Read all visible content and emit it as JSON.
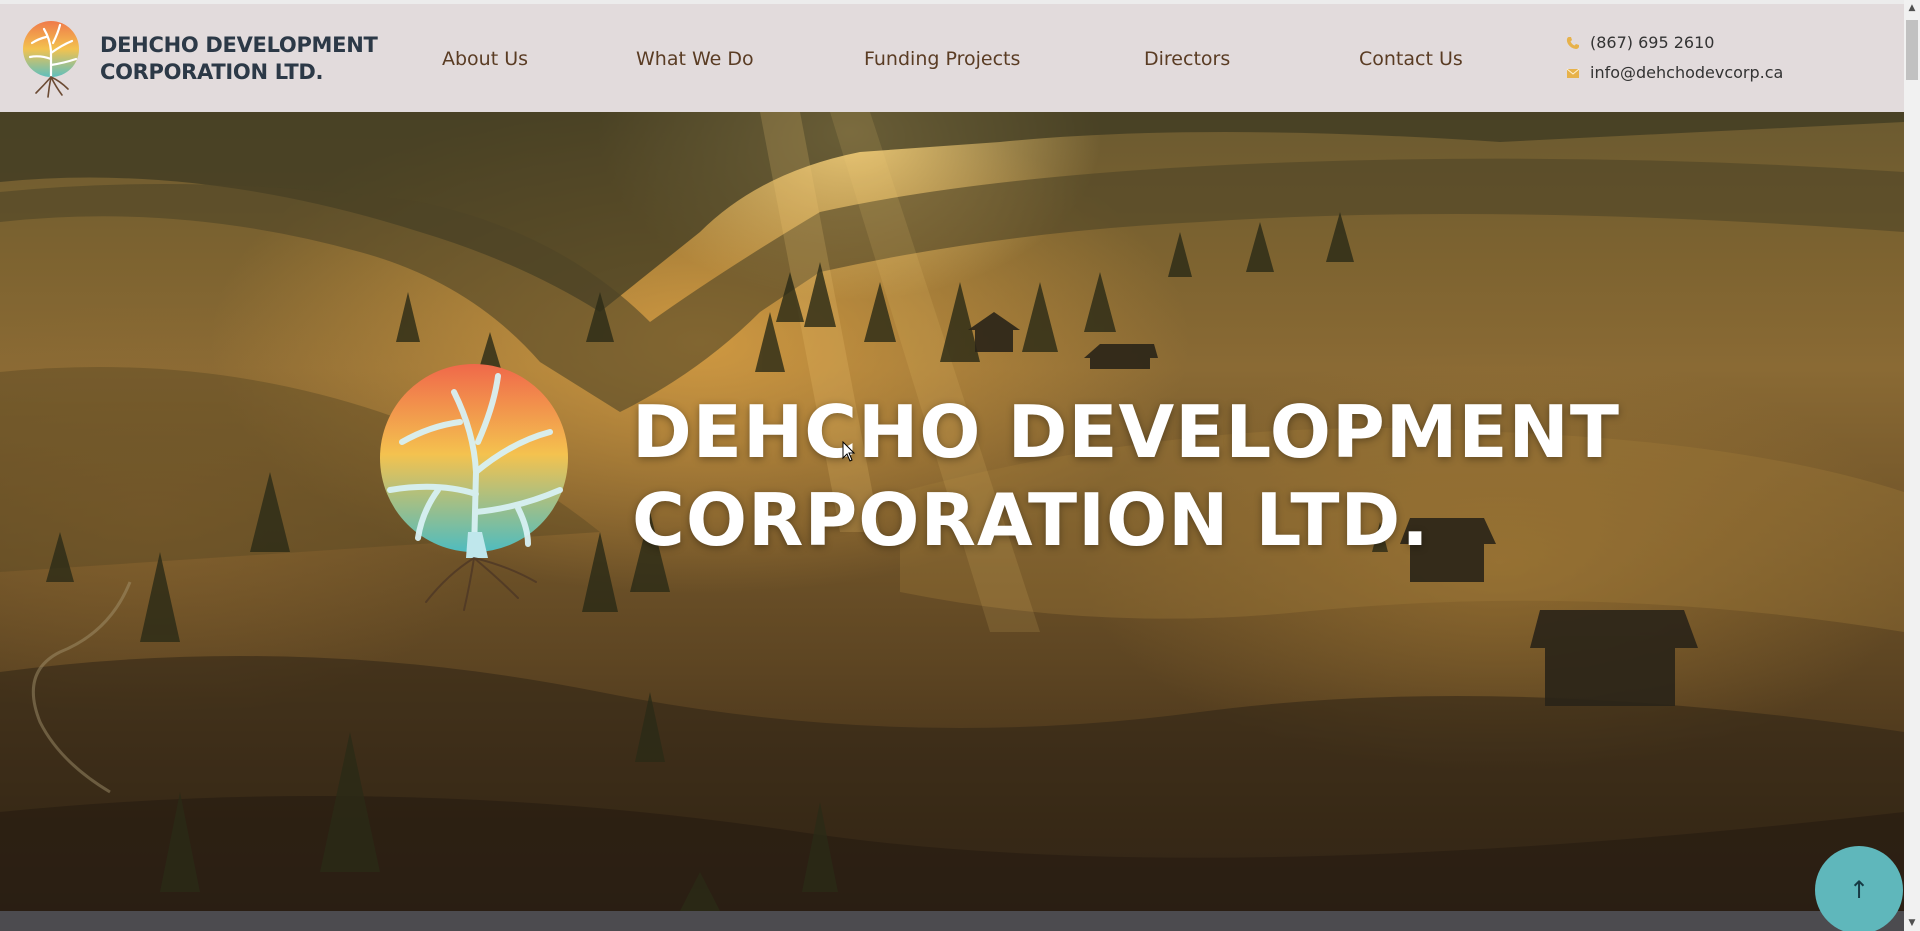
{
  "header": {
    "brand": {
      "line1": "DEHCHO DEVELOPMENT",
      "line2": "CORPORATION LTD."
    },
    "nav": [
      {
        "label": "About Us"
      },
      {
        "label": "What We Do"
      },
      {
        "label": "Funding Projects"
      },
      {
        "label": "Directors"
      },
      {
        "label": "Contact Us"
      }
    ],
    "contact": {
      "phone": "(867) 695 2610",
      "email": "info@dehchodevcorp.ca",
      "phone_icon": "phone-icon",
      "email_icon": "envelope-icon"
    }
  },
  "hero": {
    "title_line1": "DEHCHO DEVELOPMENT",
    "title_line2": "CORPORATION LTD."
  },
  "back_to_top": {
    "symbol": "↑",
    "icon": "arrow-up-icon"
  },
  "colors": {
    "header_bg": "#e2dbdc",
    "nav_text": "#5a3c24",
    "brand_text": "#2c3947",
    "accent_teal": "#5fb7bb",
    "icon_gold": "#e7b24b"
  }
}
